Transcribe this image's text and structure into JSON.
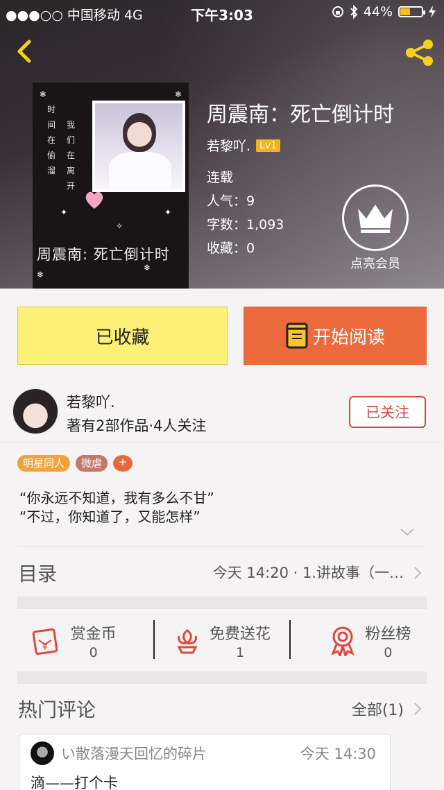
{
  "status_bar": {
    "carrier": "●●●○○ 中国移动  4G",
    "time": "下午3:03",
    "battery": "44%",
    "battery_level": 0.44
  },
  "book": {
    "title": "周震南：死亡倒计时",
    "author": "若黎吖.",
    "level": "Lv1",
    "status": "连载",
    "popularity": "人气：9",
    "word_count": "字数：1,093",
    "favorites": "收藏：0",
    "cover": {
      "poem_col1": "时间在偷溜",
      "poem_col2": "我们在离开",
      "title": "周震南:  死亡倒计时"
    }
  },
  "vip": {
    "label": "点亮会员"
  },
  "actions": {
    "favorite_label": "已收藏",
    "read_label": "开始阅读"
  },
  "author_card": {
    "name": "若黎吖.",
    "meta": "著有2部作品·4人关注",
    "follow_label": "已关注"
  },
  "tags": [
    "明星同人",
    "微虐",
    "+"
  ],
  "synopsis": {
    "line1": "“你永远不知道，我有多么不甘”",
    "line2": "“不过，你知道了，又能怎样”"
  },
  "toc": {
    "label": "目录",
    "latest": "今天 14:20 · 1.讲故事（一…"
  },
  "stats": [
    {
      "label": "赏金币",
      "value": "0",
      "icon": "red-envelope-icon"
    },
    {
      "label": "免费送花",
      "value": "1",
      "icon": "flower-icon"
    },
    {
      "label": "粉丝榜",
      "value": "0",
      "icon": "ribbon-badge-icon"
    }
  ],
  "comments_section": {
    "label": "热门评论",
    "all_label": "全部(1)"
  },
  "comments": [
    {
      "user": "い散落漫天回忆的碎片",
      "time": "今天 14:30",
      "text": "滴——打个卡"
    }
  ],
  "colors": {
    "favorite_bg": "#fdf076",
    "read_bg": "#ec6a3c",
    "follow": "#d9473d",
    "accent_icon": "#e0463a",
    "level_badge": "#f5b31b"
  }
}
